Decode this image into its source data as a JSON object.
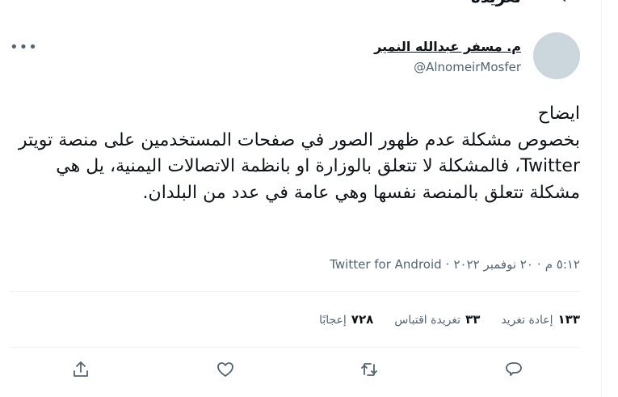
{
  "header": {
    "title": "تغريدة",
    "back_icon": "arrow-icon"
  },
  "author": {
    "name": "م. مسفر عبدالله النمير",
    "handle": "@AlnomeirMosfer",
    "more_icon": "ellipsis-icon"
  },
  "tweet": {
    "text": "ايضاح\nبخصوص مشكلة عدم ظهور الصور في صفحات المستخدمين على منصة تويتر Twitter، فالمشكلة لا تتعلق بالوزارة او بانظمة الاتصالات اليمنية، يل هي مشكلة تتعلق بالمنصة نفسها وهي عامة في عدد من البلدان."
  },
  "meta": {
    "time": "٥:١٢ م",
    "dot1": "·",
    "date": "٢٠ نوفمبر ٢٠٢٢",
    "dot2": "·",
    "source": "Twitter for Android"
  },
  "stats": {
    "retweets_count": "١٣٣",
    "retweets_label": "إعادة تغريد",
    "quotes_count": "٣٣",
    "quotes_label": "تغريدة اقتباس",
    "likes_count": "٧٢٨",
    "likes_label": "إعجابًا"
  },
  "actions": [
    "reply-icon",
    "retweet-icon",
    "like-icon",
    "share-icon"
  ],
  "colors": {
    "text_primary": "#0f1419",
    "text_secondary": "#536471",
    "border": "#eff3f4"
  }
}
